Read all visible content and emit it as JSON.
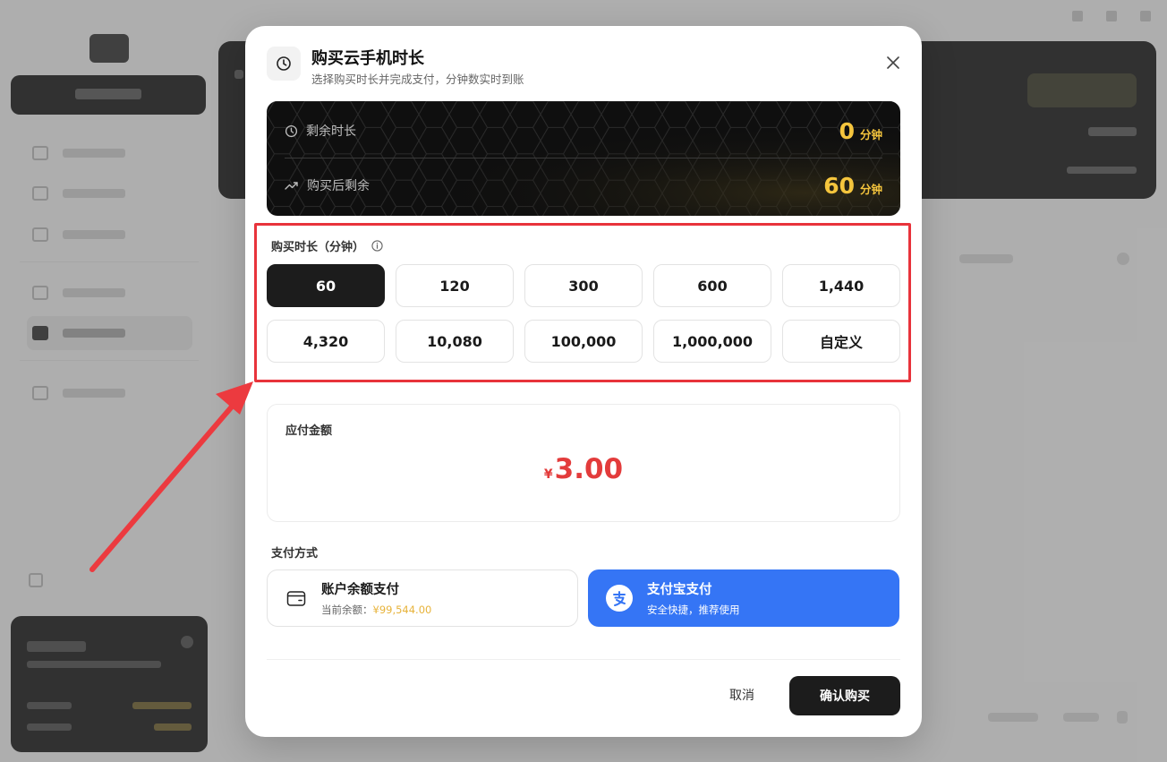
{
  "dialog": {
    "title": "购买云手机时长",
    "subtitle": "选择购买时长并完成支付，分钟数实时到账",
    "icon": "clock-icon",
    "close_icon": "close-icon"
  },
  "summary": {
    "remaining_label": "剩余时长",
    "remaining_value": "0",
    "remaining_unit": "分钟",
    "after_label": "购买后剩余",
    "after_value": "60",
    "after_unit": "分钟",
    "accent_color": "#f5c53d"
  },
  "duration": {
    "label": "购买时长（分钟）",
    "info_icon": "info-icon",
    "selected": "60",
    "options": [
      "60",
      "120",
      "300",
      "600",
      "1,440",
      "4,320",
      "10,080",
      "100,000",
      "1,000,000",
      "自定义"
    ]
  },
  "amount": {
    "label": "应付金额",
    "currency": "¥",
    "value": "3.00",
    "color": "#e33b3b"
  },
  "payment": {
    "label": "支付方式",
    "balance": {
      "title": "账户余额支付",
      "sub_prefix": "当前余额：",
      "sub_amount": "¥99,544.00",
      "icon": "wallet-icon"
    },
    "alipay": {
      "title": "支付宝支付",
      "sub": "安全快捷，推荐使用",
      "icon": "alipay-icon",
      "color": "#3575f5"
    }
  },
  "footer": {
    "cancel": "取消",
    "confirm": "确认购买"
  },
  "annotation": {
    "color": "#e8333b"
  }
}
